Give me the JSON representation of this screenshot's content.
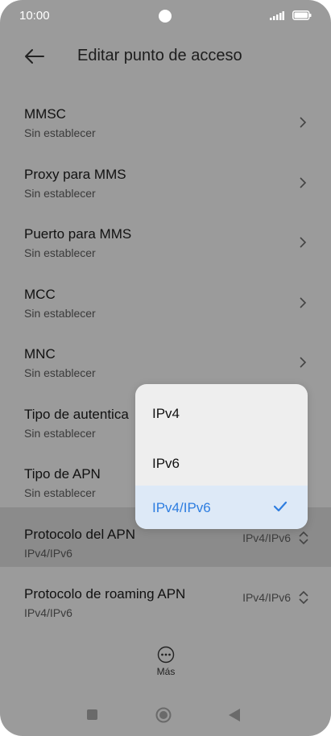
{
  "status_bar": {
    "time": "10:00"
  },
  "header": {
    "title": "Editar punto de acceso"
  },
  "rows": [
    {
      "title": "MMSC",
      "subtitle": "Sin establecer"
    },
    {
      "title": "Proxy para MMS",
      "subtitle": "Sin establecer"
    },
    {
      "title": "Puerto para MMS",
      "subtitle": "Sin establecer"
    },
    {
      "title": "MCC",
      "subtitle": "Sin establecer"
    },
    {
      "title": "MNC",
      "subtitle": "Sin establecer"
    },
    {
      "title": "Tipo de autentica",
      "subtitle": "Sin establecer"
    },
    {
      "title": "Tipo de APN",
      "subtitle": "Sin establecer"
    },
    {
      "title": "Protocolo del APN",
      "subtitle": "IPv4/IPv6",
      "value": "IPv4/IPv6"
    },
    {
      "title": "Protocolo de roaming APN",
      "subtitle": "IPv4/IPv6",
      "value": "IPv4/IPv6"
    }
  ],
  "popup": {
    "options": [
      "IPv4",
      "IPv6",
      "IPv4/IPv6"
    ],
    "selected": "IPv4/IPv6"
  },
  "more": {
    "label": "Más"
  },
  "colors": {
    "accent": "#2d7de0",
    "overlay": "#9b9b9b",
    "popup_bg": "#eeeeee"
  }
}
